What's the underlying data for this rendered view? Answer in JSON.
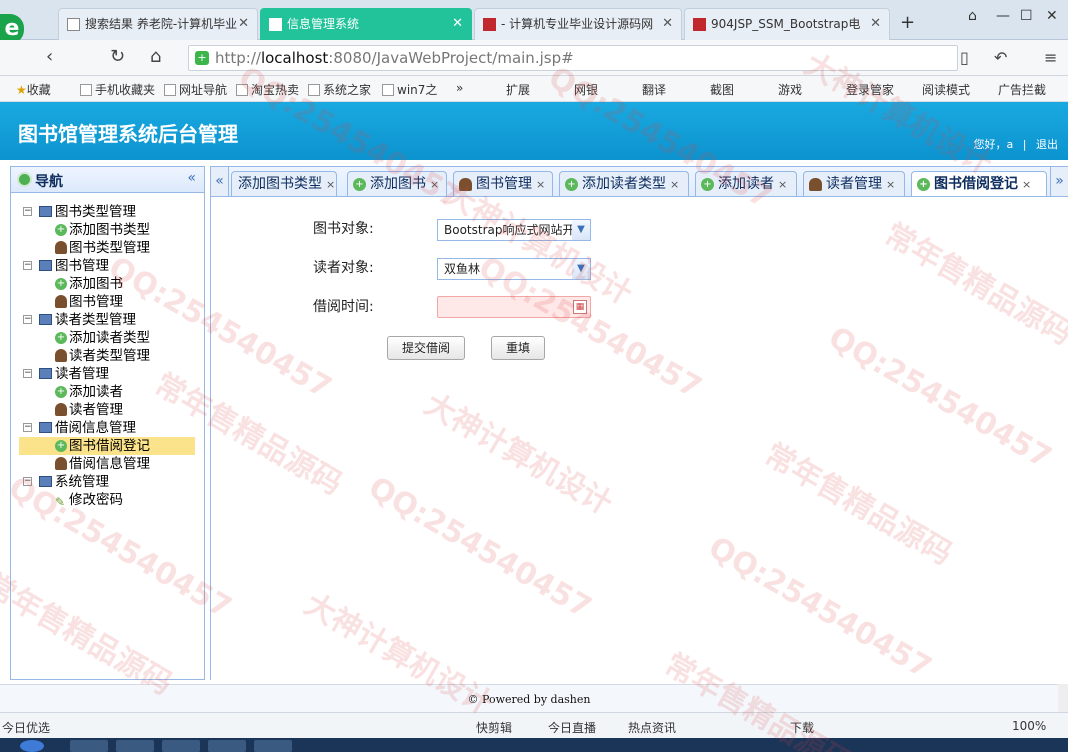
{
  "browser": {
    "tabs": [
      {
        "title": "搜索结果 养老院-计算机毕业",
        "active": false
      },
      {
        "title": "信息管理系统",
        "active": true
      },
      {
        "title": "- 计算机专业毕业设计源码网",
        "active": false
      },
      {
        "title": "904JSP_SSM_Bootstrap电",
        "active": false
      }
    ],
    "new_tab": "+",
    "url_host": "localhost",
    "url_prefix": "http://",
    "url_rest": ":8080/JavaWebProject/main.jsp#",
    "bookmarks": [
      "收藏",
      "手机收藏夹",
      "网址导航",
      "淘宝热卖",
      "系统之家",
      "win7之",
      "»"
    ],
    "tools": [
      "扩展",
      "网银",
      "翻译",
      "截图",
      "游戏",
      "登录管家",
      "阅读模式",
      "广告拦截"
    ]
  },
  "app": {
    "title": "图书馆管理系统后台管理",
    "greeting": "您好，a",
    "separator": "|",
    "logout": "退出"
  },
  "nav": {
    "title": "导航",
    "collapse": "«",
    "tree": [
      {
        "label": "图书类型管理",
        "children": [
          {
            "label": "添加图书类型",
            "icon": "add"
          },
          {
            "label": "图书类型管理",
            "icon": "user"
          }
        ]
      },
      {
        "label": "图书管理",
        "children": [
          {
            "label": "添加图书",
            "icon": "add"
          },
          {
            "label": "图书管理",
            "icon": "user"
          }
        ]
      },
      {
        "label": "读者类型管理",
        "children": [
          {
            "label": "添加读者类型",
            "icon": "add"
          },
          {
            "label": "读者类型管理",
            "icon": "user"
          }
        ]
      },
      {
        "label": "读者管理",
        "children": [
          {
            "label": "添加读者",
            "icon": "add"
          },
          {
            "label": "读者管理",
            "icon": "user"
          }
        ]
      },
      {
        "label": "借阅信息管理",
        "children": [
          {
            "label": "图书借阅登记",
            "icon": "add",
            "selected": true
          },
          {
            "label": "借阅信息管理",
            "icon": "user"
          }
        ]
      },
      {
        "label": "系统管理",
        "children": [
          {
            "label": "修改密码",
            "icon": "pen"
          }
        ]
      }
    ]
  },
  "tabs": [
    {
      "label": "添加图书类型",
      "icon": "none"
    },
    {
      "label": "添加图书",
      "icon": "add"
    },
    {
      "label": "图书管理",
      "icon": "user"
    },
    {
      "label": "添加读者类型",
      "icon": "add"
    },
    {
      "label": "添加读者",
      "icon": "add"
    },
    {
      "label": "读者管理",
      "icon": "user"
    },
    {
      "label": "图书借阅登记",
      "icon": "add",
      "active": true
    }
  ],
  "form": {
    "book_label": "图书对象:",
    "book_value": "Bootstrap响应式网站开",
    "reader_label": "读者对象:",
    "reader_value": "双鱼林",
    "date_label": "借阅时间:",
    "date_value": "",
    "submit": "提交借阅",
    "reset": "重填"
  },
  "footer": "© Powered by dashen",
  "statusbar": {
    "left": "今日优选",
    "items": [
      "快剪辑",
      "今日直播",
      "热点资讯",
      "下载",
      "100%"
    ]
  },
  "watermark": {
    "lines": [
      "大神计算机设计",
      "常年售精品源码",
      "QQ:254540457"
    ]
  }
}
